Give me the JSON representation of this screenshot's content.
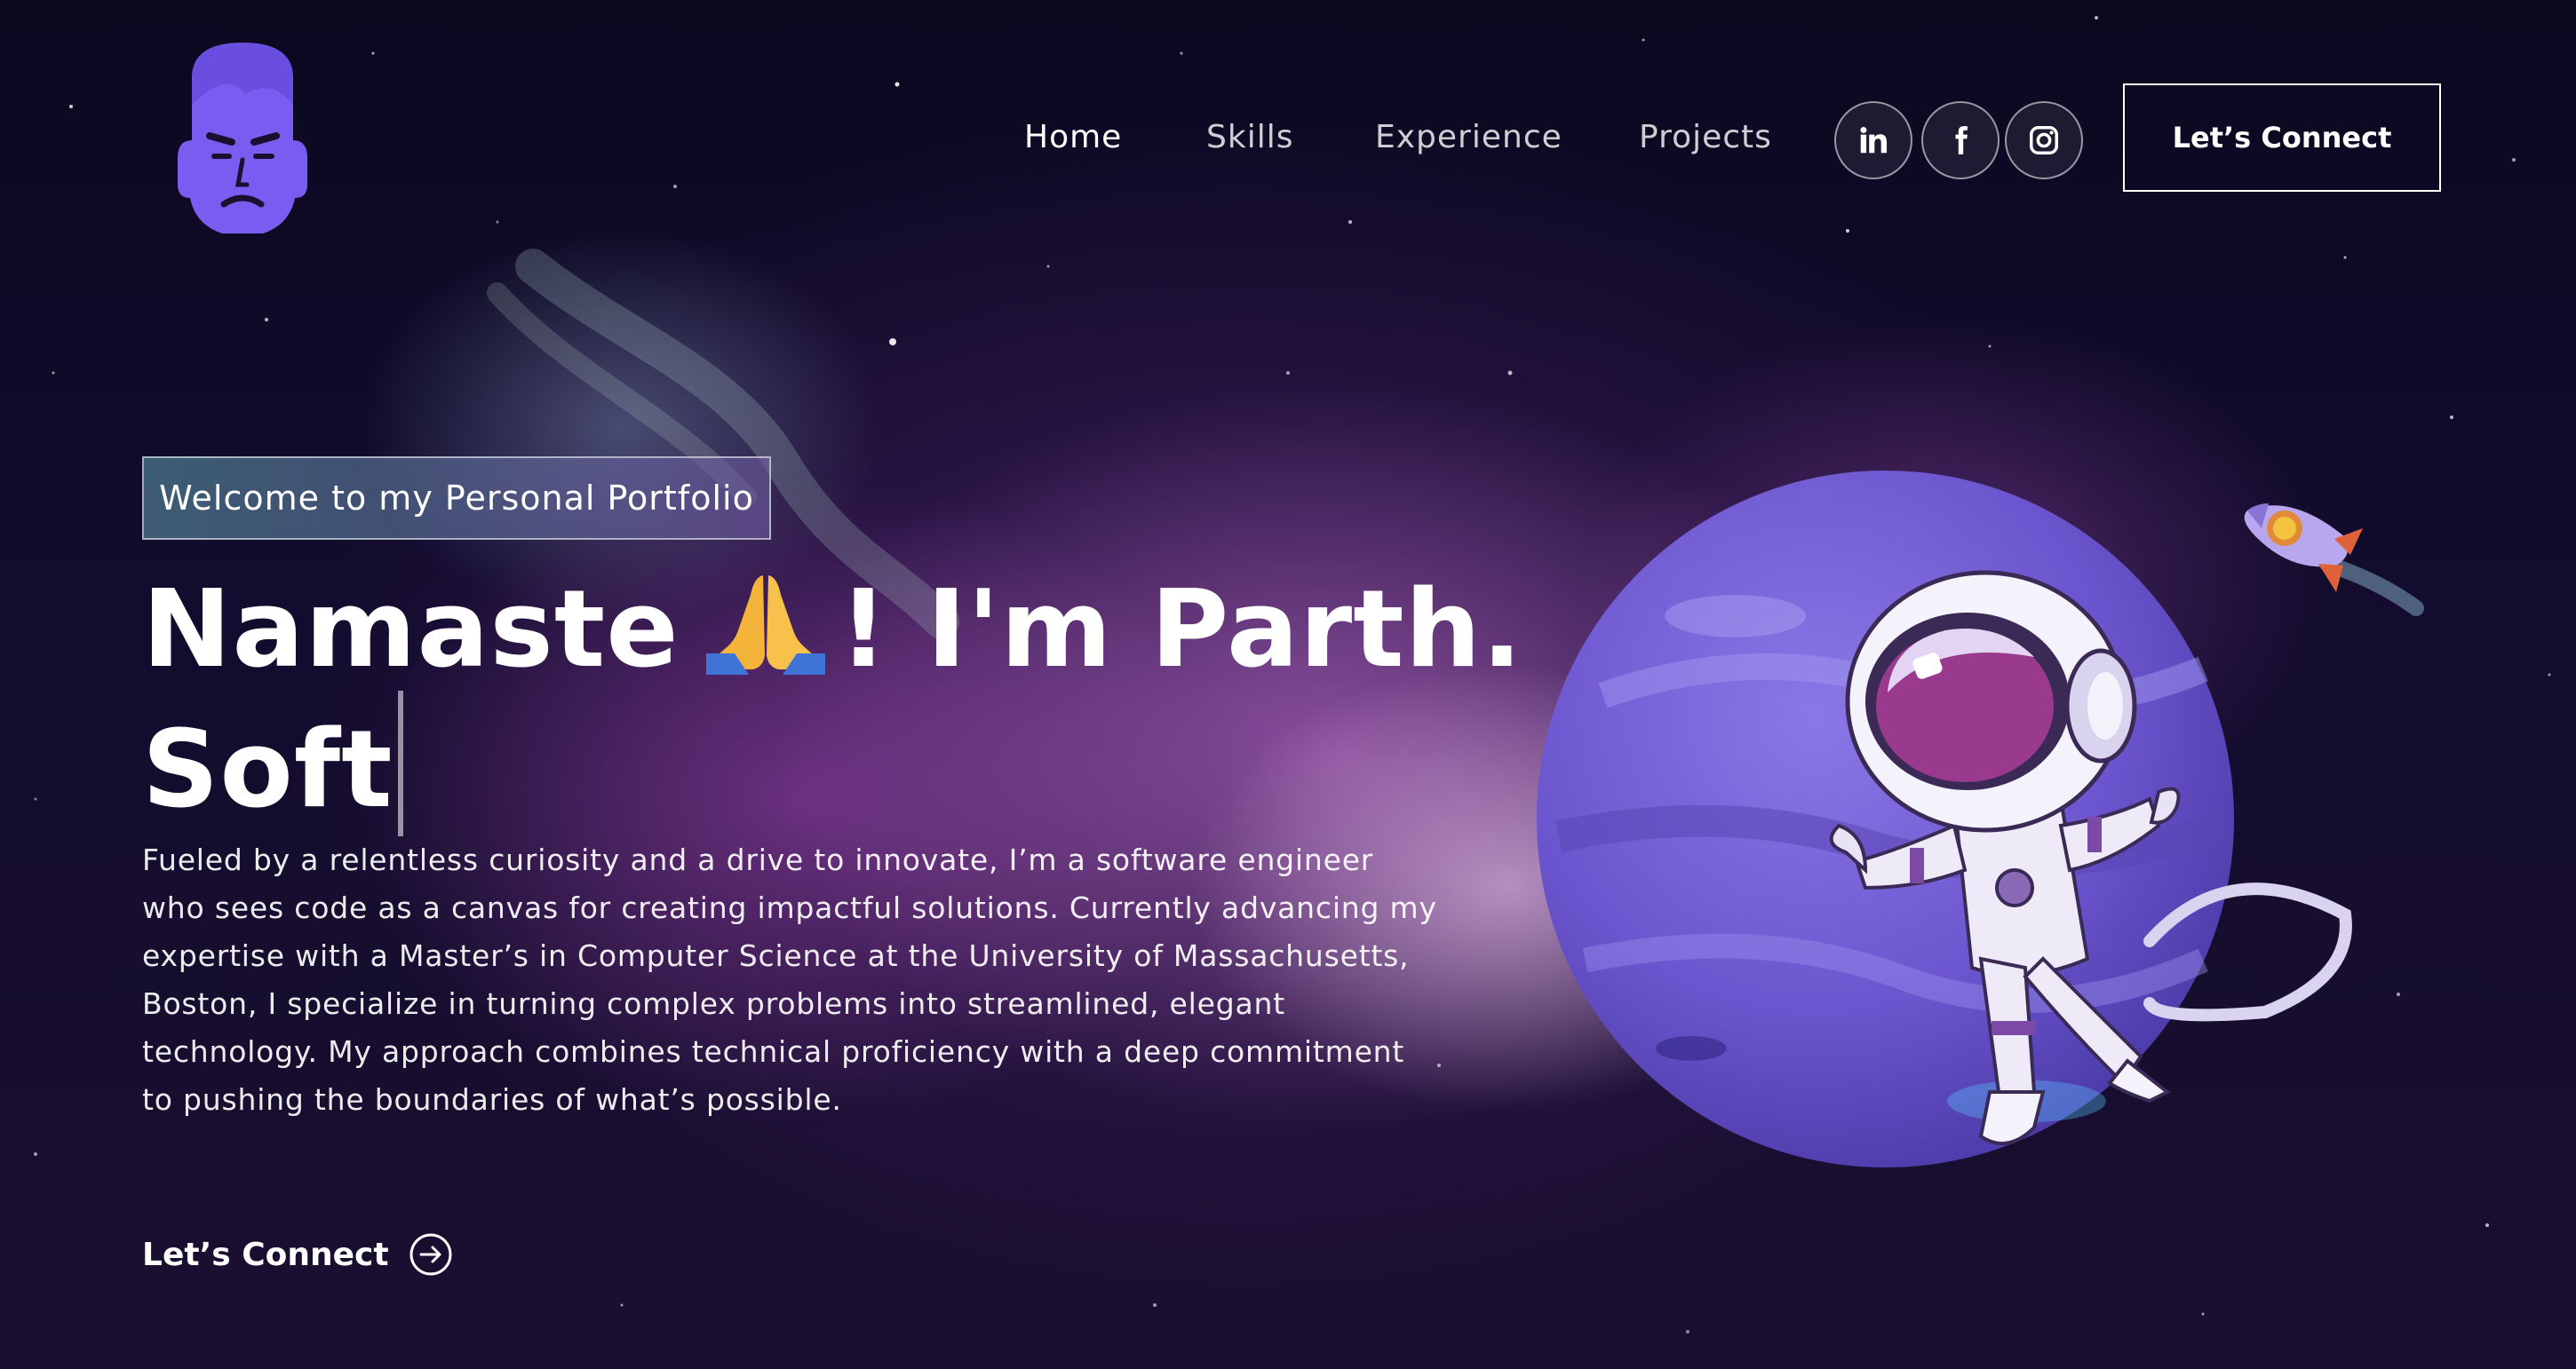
{
  "header": {
    "logo_icon": "avatar-face-icon",
    "nav": [
      {
        "label": "Home",
        "active": true
      },
      {
        "label": "Skills",
        "active": false
      },
      {
        "label": "Experience",
        "active": false
      },
      {
        "label": "Projects",
        "active": false
      }
    ],
    "social": [
      {
        "icon": "linkedin-icon"
      },
      {
        "icon": "facebook-icon"
      },
      {
        "icon": "instagram-icon"
      }
    ],
    "connect_label": "Let’s Connect"
  },
  "hero": {
    "tagline": "Welcome to my Personal Portfolio",
    "headline_part1": "Namaste",
    "headline_emoji_icon": "folded-hands-icon",
    "headline_part2": "! I'm Parth.",
    "headline_line2": "Soft",
    "bio": "Fueled by a relentless curiosity and a drive to innovate, I’m a software engineer who sees code as a canvas for creating impactful solutions. Currently advancing my expertise with a Master’s in Computer Science at the University of Massachusetts, Boston, I specialize in turning complex problems into streamlined, elegant technology. My approach combines technical proficiency with a deep commitment to pushing the boundaries of what’s possible.",
    "cta_label": "Let’s Connect",
    "cta_icon": "arrow-right-circle-icon"
  },
  "illustration": {
    "planet_icon": "planet-illustration",
    "astronaut_icon": "astronaut-illustration",
    "rocket_icon": "rocket-illustration"
  },
  "colors": {
    "accent_purple": "#7b5cf0",
    "planet": "#6f5bd0",
    "background": "#130c2e"
  }
}
